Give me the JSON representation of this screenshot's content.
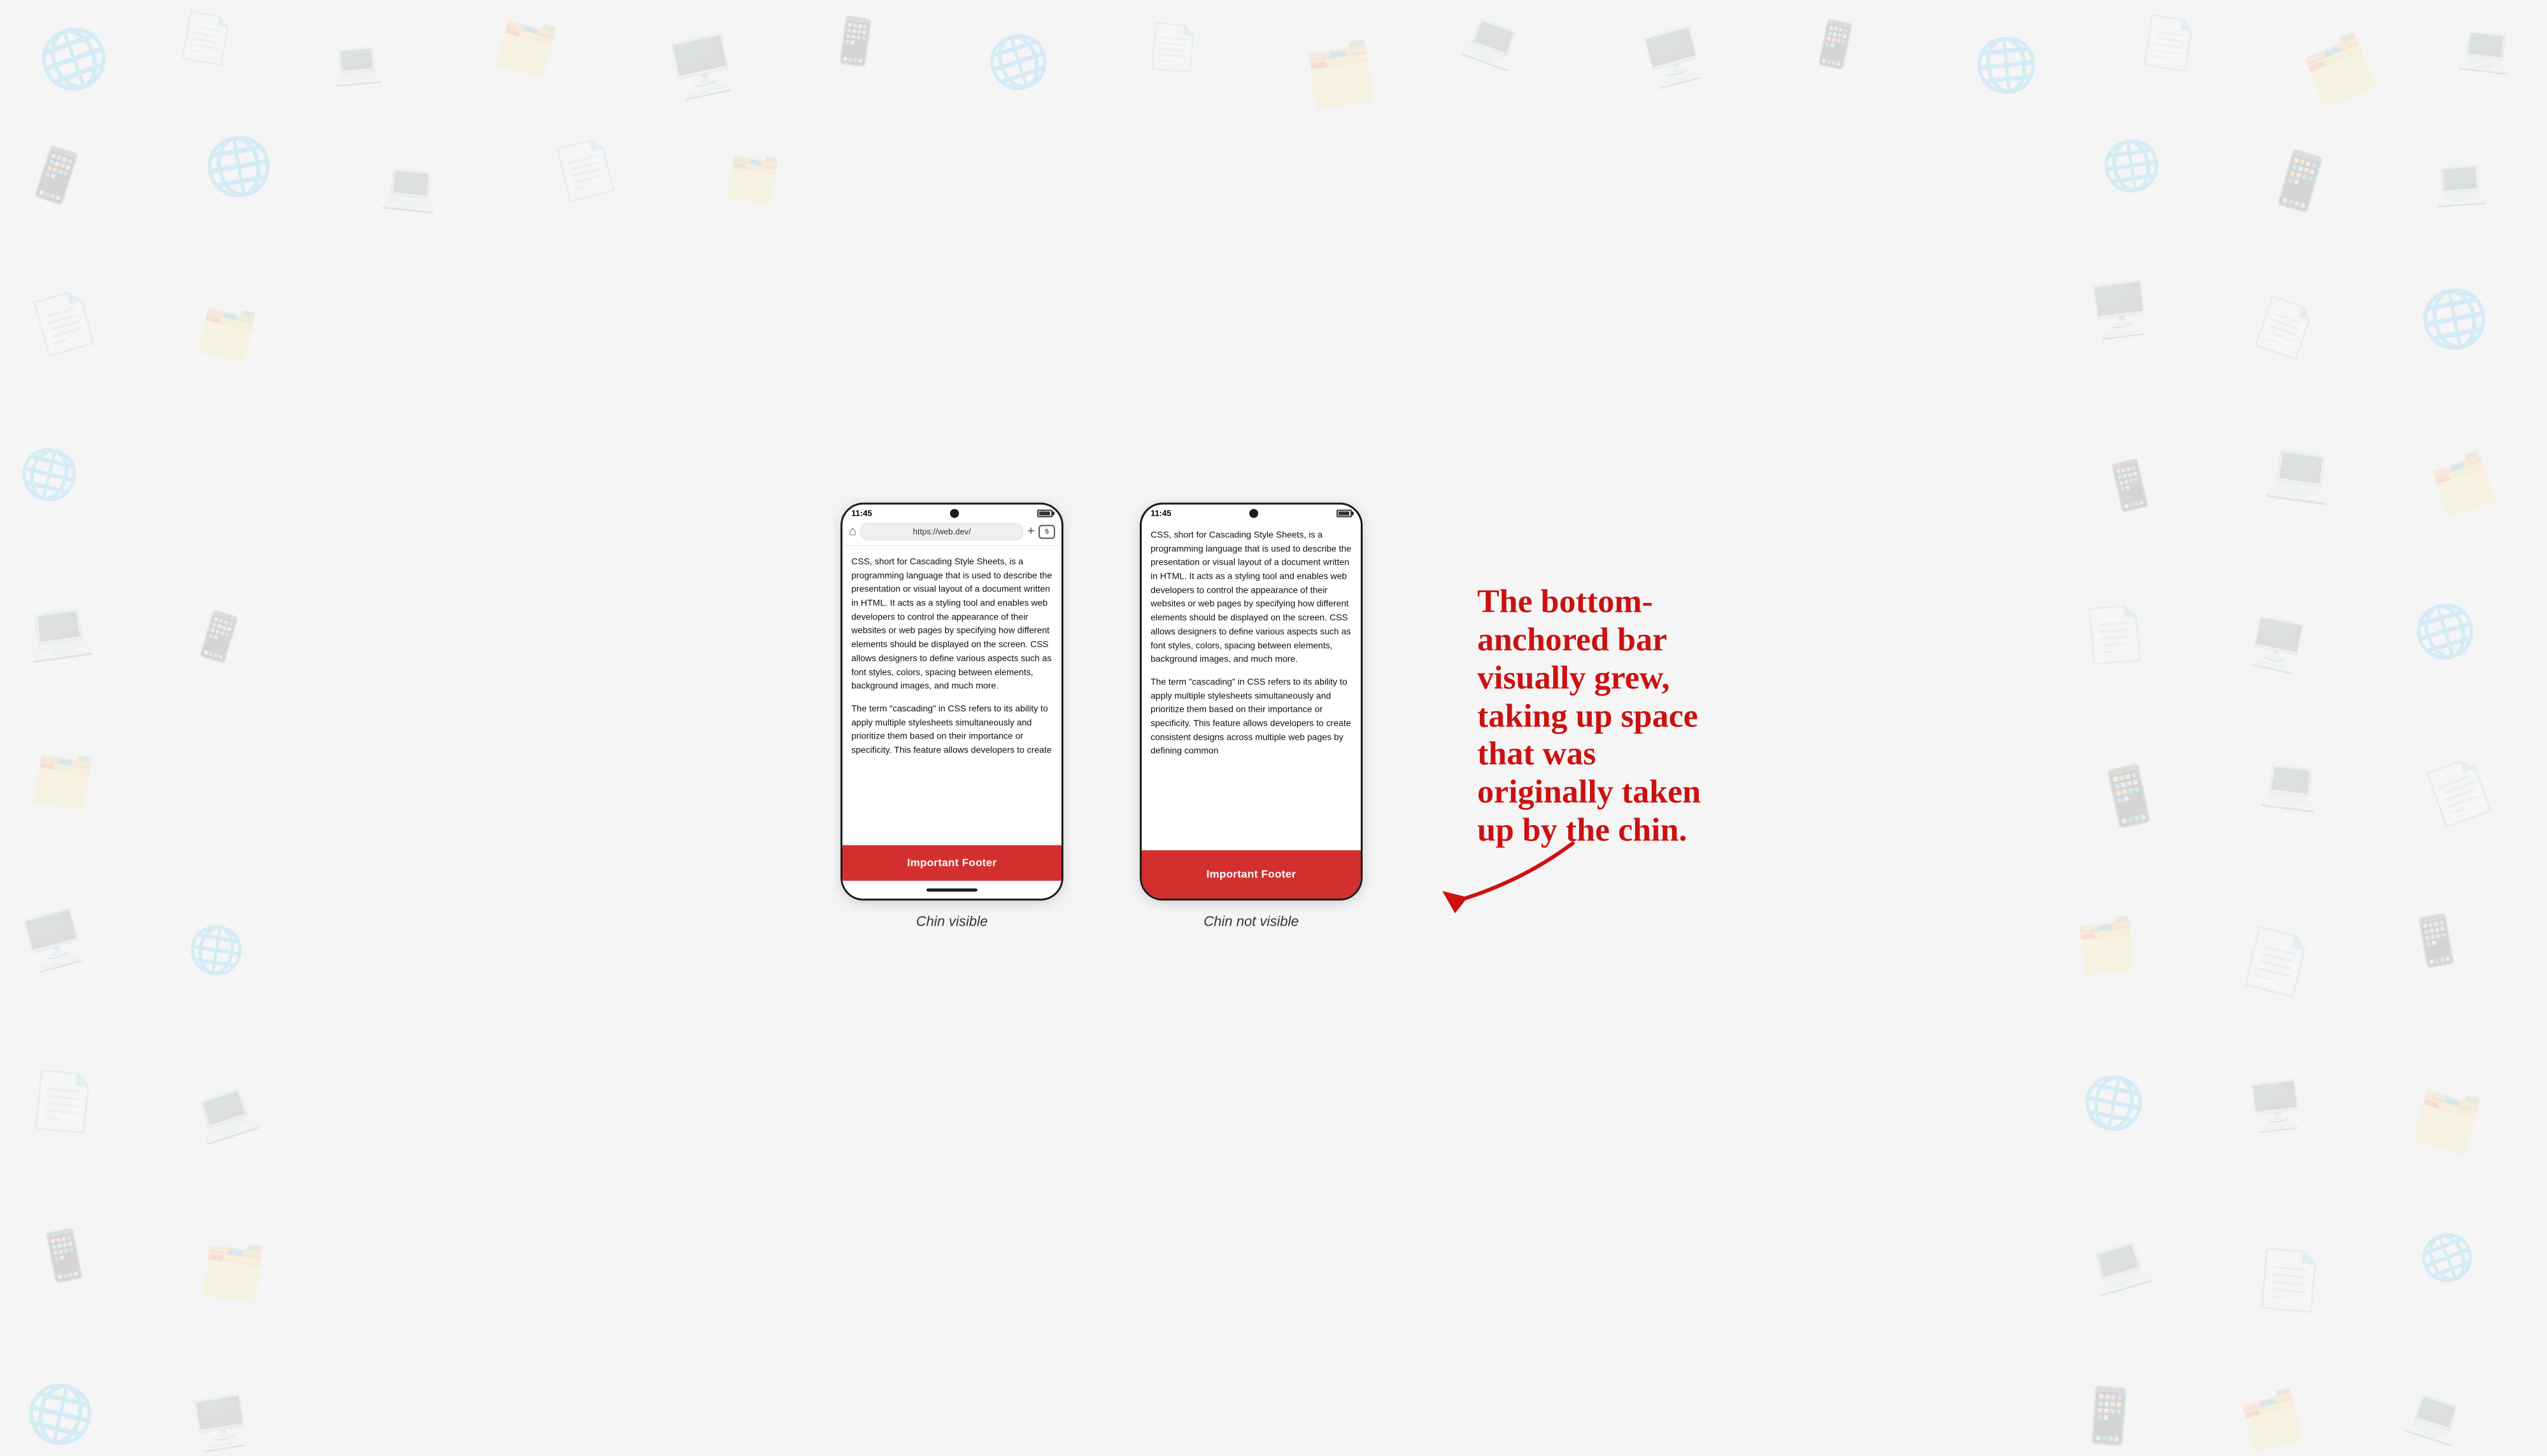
{
  "background": {
    "color": "#f0f0f0"
  },
  "left_phone": {
    "status_time": "11:45",
    "url": "https://web.dev/",
    "tab_count": "5",
    "content_paragraphs": [
      "CSS, short for Cascading Style Sheets, is a programming language that is used to describe the presentation or visual layout of a document written in HTML. It acts as a styling tool and enables web developers to control the appearance of their websites or web pages by specifying how different elements should be displayed on the screen. CSS allows designers to define various aspects such as font styles, colors, spacing between elements, background images, and much more.",
      "The term \"cascading\" in CSS refers to its ability to apply multiple stylesheets simultaneously and prioritize them based on their importance or specificity. This feature allows developers to create"
    ],
    "footer_text": "Important Footer",
    "has_chin": true,
    "caption": "Chin visible"
  },
  "right_phone": {
    "status_time": "11:45",
    "content_paragraphs": [
      "CSS, short for Cascading Style Sheets, is a programming language that is used to describe the presentation or visual layout of a document written in HTML. It acts as a styling tool and enables web developers to control the appearance of their websites or web pages by specifying how different elements should be displayed on the screen. CSS allows designers to define various aspects such as font styles, colors, spacing between elements, background images, and much more.",
      "The term \"cascading\" in CSS refers to its ability to apply multiple stylesheets simultaneously and prioritize them based on their importance or specificity. This feature allows developers to create consistent designs across multiple web pages by defining common"
    ],
    "footer_text": "Important Footer",
    "has_chin": false,
    "caption": "Chin not visible"
  },
  "annotation": {
    "line1": "The bottom-",
    "line2": "anchored bar",
    "line3": "visually grew,",
    "line4": "taking up space",
    "line5": "that was",
    "line6": "originally taken",
    "line7": "up by the chin."
  }
}
